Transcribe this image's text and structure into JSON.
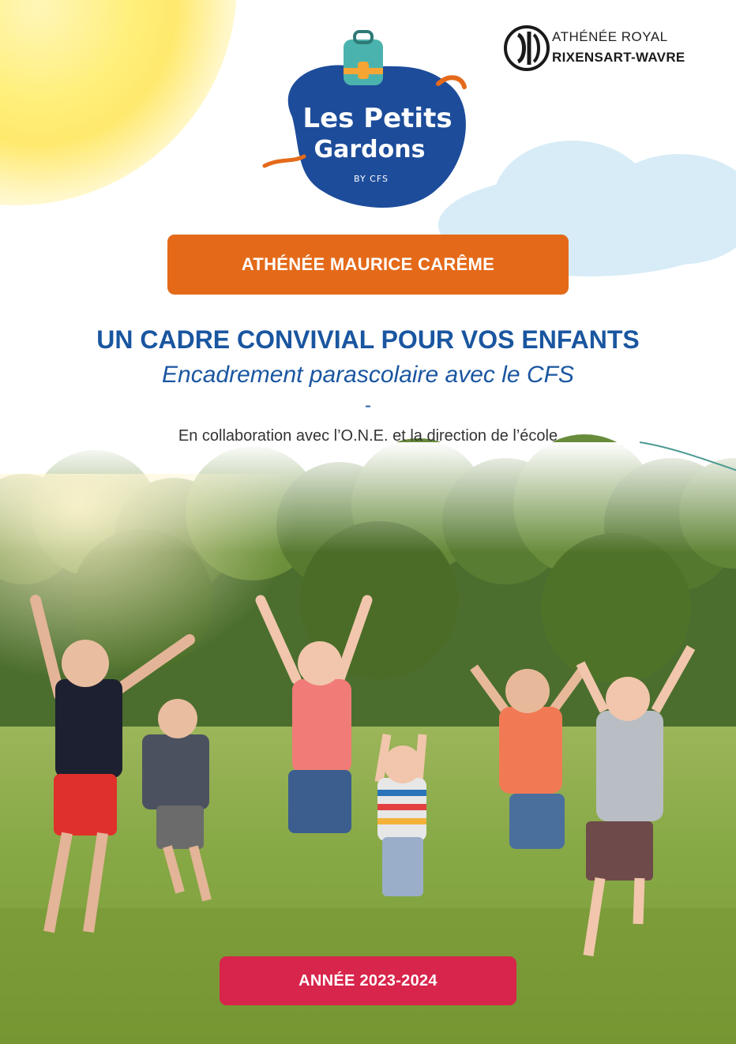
{
  "logos": {
    "petits_gardons": {
      "line1": "Les Petits",
      "line2": "Gardons",
      "line3": "BY CFS",
      "icon": "backpack-icon"
    },
    "athenee_royal": {
      "line1": "ATHÉNÉE ROYAL",
      "line2": "RIXENSART-WAVRE",
      "icon": "athenee-emblem-icon"
    }
  },
  "school_name": "ATHÉNÉE MAURICE CARÊME",
  "headline": "UN CADRE CONVIVIAL POUR VOS ENFANTS",
  "subheadline": "Encadrement parascolaire avec le CFS",
  "separator": "-",
  "collaboration": "En collaboration avec l’O.N.E. et la direction de l’école",
  "year": "ANNÉE 2023-2024",
  "colors": {
    "blue": "#1a56a0",
    "orange": "#e46a1a",
    "pink": "#d8254b",
    "logo_blue": "#1d4c9a",
    "sun": "#ffe96d",
    "cloud": "#d7ecf7"
  }
}
